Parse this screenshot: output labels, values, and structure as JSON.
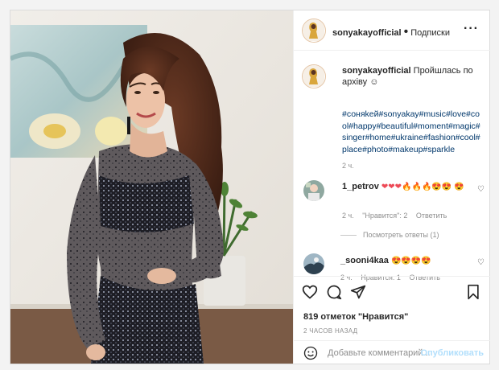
{
  "post": {
    "username": "sonyakayofficial",
    "follow_label": "Подписки",
    "dot": "•",
    "more_glyph": "···",
    "caption": {
      "username": "sonyakayofficial",
      "text": "Пройшлась по архіву ☺",
      "hashtags": "#соняkей#sonyakay#music#love#cool#happy#beautiful#moment#magic#singer#home#ukraine#fashion#cool#place#photo#makeup#sparkle",
      "time": "2 ч."
    },
    "comments": [
      {
        "username": "1_petrov",
        "text": "❤❤❤🔥🔥🔥😍😍 😍",
        "time": "2 ч.",
        "likes_label": "\"Нравится\": 2",
        "reply_label": "Ответить"
      },
      {
        "username": "_sooni4kaa",
        "text": "😍😍😍😍",
        "time": "2 ч.",
        "likes_label": "Нравится: 1",
        "reply_label": "Ответить"
      }
    ],
    "view_replies": "Посмотреть ответы (1)",
    "likes_text": "819 отметок \"Нравится\"",
    "posted_ago": "2 ЧАСОВ НАЗАД",
    "comment_placeholder": "Добавьте комментарий...",
    "publish_label": "Опубликовать",
    "colors": {
      "link": "#00376b",
      "muted": "#8e8e8e",
      "publish_disabled": "#b2dffc",
      "heart_red": "#ed4956"
    }
  }
}
